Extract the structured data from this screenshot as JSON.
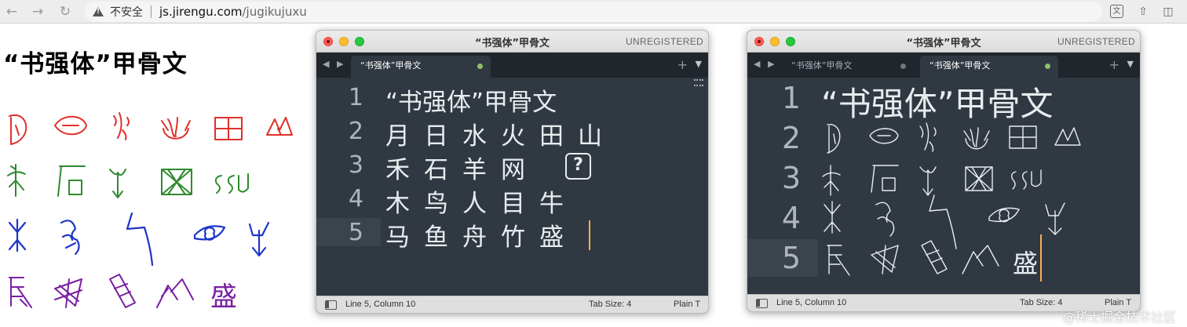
{
  "browser": {
    "back_icon": "back-arrow-icon",
    "forward_icon": "forward-arrow-icon",
    "reload_icon": "reload-icon",
    "insecure_label": "不安全",
    "url_host": "js.jirengu.com",
    "url_path": "/jugikujuxu"
  },
  "page": {
    "title": "“书强体”甲骨文"
  },
  "editor_left": {
    "window_title": "“书强体”甲骨文",
    "unregistered": "UNREGISTERED",
    "tabs": [
      {
        "label": "“书强体”甲骨文",
        "active": true
      }
    ],
    "lines": [
      {
        "num": "1",
        "text": "“书强体”甲骨文"
      },
      {
        "num": "2",
        "text": "月日水火田山"
      },
      {
        "num": "3",
        "text": "禾石羊网"
      },
      {
        "num": "4",
        "text": "木鸟人目牛"
      },
      {
        "num": "5",
        "text": "马鱼舟竹盛"
      }
    ],
    "missing_glyph": "?",
    "status": {
      "position": "Line 5, Column 10",
      "tab_size": "Tab Size: 4",
      "syntax": "Plain T"
    }
  },
  "editor_right": {
    "window_title": "“书强体”甲骨文",
    "unregistered": "UNREGISTERED",
    "tabs": [
      {
        "label": "“书强体”甲骨文",
        "active": false
      },
      {
        "label": "“书强体”甲骨文",
        "active": true
      }
    ],
    "lines": [
      {
        "num": "1",
        "text": "“书强体”甲骨文"
      },
      {
        "num": "2",
        "text": ""
      },
      {
        "num": "3",
        "text": ""
      },
      {
        "num": "4",
        "text": ""
      },
      {
        "num": "5",
        "text": ""
      }
    ],
    "status": {
      "position": "Line 5, Column 10",
      "tab_size": "Tab Size: 4",
      "syntax": "Plain T"
    }
  },
  "watermark": "@稀土掘金技术社区",
  "colors": {
    "editor_bg": "#303841",
    "tabbar_bg": "#21262c",
    "cursor": "#f9ae58",
    "glyph_row1": "#e0302a",
    "glyph_row2": "#2f8a2f",
    "glyph_row3": "#1f35c8",
    "glyph_row4": "#7a1fa2"
  }
}
